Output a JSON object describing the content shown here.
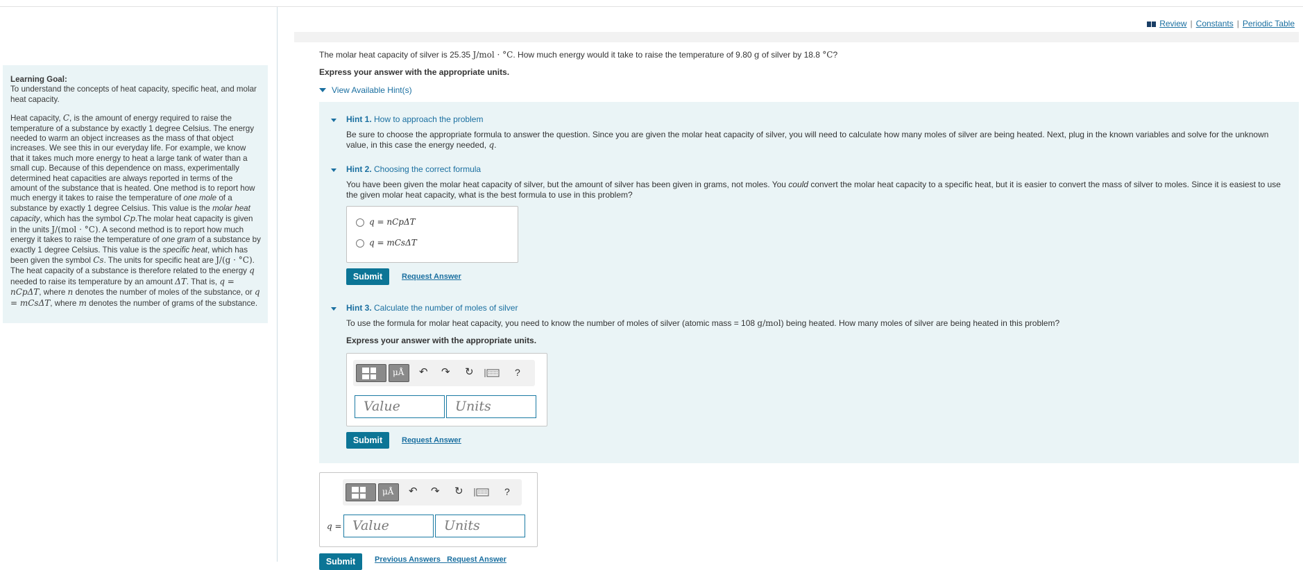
{
  "header": {
    "review": "Review",
    "constants": "Constants",
    "periodic_table": "Periodic Table",
    "separator": "|"
  },
  "learning_goal": {
    "title": "Learning Goal:",
    "goal": "To understand the concepts of heat capacity, specific heat, and molar heat capacity.",
    "p1": "Heat capacity, ",
    "sym_C": "C",
    "p2": ", is the amount of energy required to raise the temperature of a substance by exactly 1 degree Celsius. The energy needed to warm an object increases as the mass of that object increases. We see this in our everyday life. For example, we know that it takes much more energy to heat a large tank of water than a small cup. Because of this dependence on mass, experimentally determined heat capacities are always reported in terms of the amount of the substance that is heated. One method is to report how much energy it takes to raise the temperature of ",
    "em_one_mole": "one mole",
    "p3": " of a substance by exactly 1 degree Celsius. This value is the ",
    "em_molar_heat": "molar heat capacity",
    "p4": ", which has the symbol ",
    "sym_Cp": "Cp",
    "p5": ".The molar heat capacity is given in the units ",
    "unit_molar": "J/(mol · °C)",
    "p6": ". A second method is to report how much energy it takes to raise the temperature of ",
    "em_one_gram": "one gram",
    "p7": " of a substance by exactly 1 degree Celsius. This value is the ",
    "em_specific": "specific heat",
    "p8": ", which has been given the symbol ",
    "sym_Cs": "Cs",
    "p9": ". The units for specific heat are ",
    "unit_specific": "J/(g · °C)",
    "p10": ". The heat capacity of a substance is therefore related to the energy ",
    "sym_q": "q",
    "p11": " needed to raise its temperature by an amount ",
    "sym_dT": "ΔT",
    "p12": ". That is, ",
    "eq1": "q = nCpΔT",
    "p13": ", where ",
    "sym_n": "n",
    "p14": " denotes the number of moles of the substance, or ",
    "eq2": "q = mCsΔT",
    "p15": ", where ",
    "sym_m": "m",
    "p16": " denotes the number of grams of the substance."
  },
  "question": {
    "text_a": "The molar heat capacity of silver is 25.35 ",
    "unit_a": "J/mol · °C",
    "text_b": ". How much energy would it take to raise the temperature of 9.80 ",
    "unit_b": "g",
    "text_c": " of silver by 18.8 ",
    "unit_c": "°C",
    "text_d": "?",
    "express": "Express your answer with the appropriate units.",
    "view_hints": "View Available Hint(s)"
  },
  "hints": {
    "h1_num": "Hint 1.",
    "h1_title": "How to approach the problem",
    "h1_text": "Be sure to choose the appropriate formula to answer the question. Since you are given the molar heat capacity of silver, you will need to calculate how many moles of silver are being heated. Next, plug in the known variables and solve for the unknown value, in this case the energy needed, ",
    "h1_sym": "q",
    "h1_end": ".",
    "h2_num": "Hint 2.",
    "h2_title": "Choosing the correct formula",
    "h2_text_a": "You have been given the molar heat capacity of silver, but the amount of silver has been given in grams, not moles. You ",
    "h2_em": "could",
    "h2_text_b": " convert the molar heat capacity to a specific heat, but it is easier to convert the mass of silver to moles. Since it is easiest to use the given molar heat capacity, what is the best formula to use in this problem?",
    "choice1": "q = nCpΔT",
    "choice2": "q = mCsΔT",
    "h3_num": "Hint 3.",
    "h3_title": "Calculate the number of moles of silver",
    "h3_text_a": "To use the formula for molar heat capacity, you need to know the number of moles of silver (atomic mass = 108 ",
    "h3_unit": "g/mol",
    "h3_text_b": ") being heated. How many moles of silver are being heated in this problem?",
    "h3_express": "Express your answer with the appropriate units."
  },
  "answer": {
    "value_placeholder": "Value",
    "units_placeholder": "Units",
    "q_label": "q =",
    "mu_label": "μÅ",
    "help": "?"
  },
  "buttons": {
    "submit": "Submit",
    "request_answer": "Request Answer",
    "previous_answers": "Previous Answers"
  }
}
